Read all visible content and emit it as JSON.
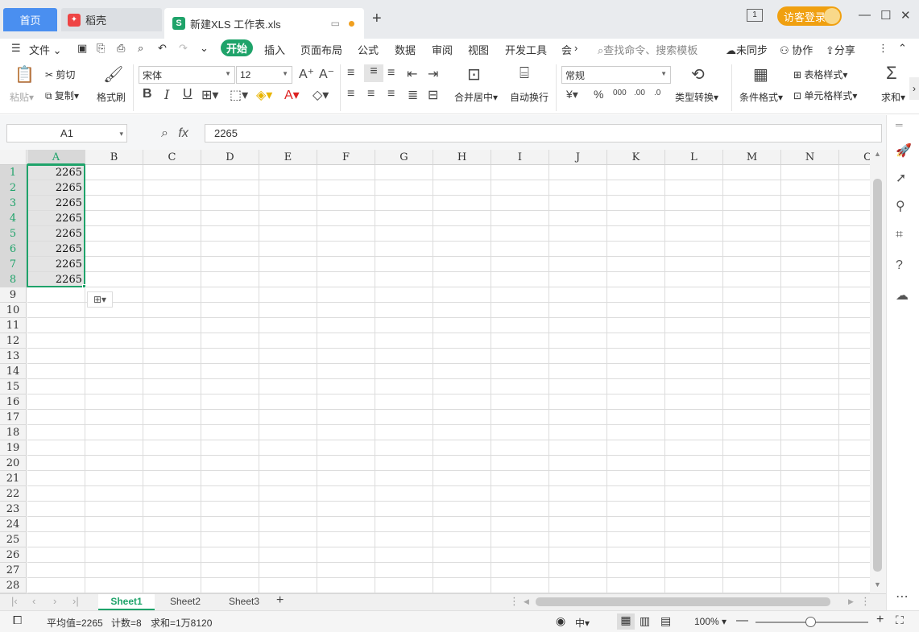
{
  "titlebar": {
    "tabs": [
      {
        "label": "首页"
      },
      {
        "label": "稻壳"
      },
      {
        "label": "新建XLS 工作表.xls"
      }
    ],
    "login_label": "访客登录",
    "page_indicator": "1"
  },
  "menu": {
    "file_label": "文件",
    "items": [
      "开始",
      "插入",
      "页面布局",
      "公式",
      "数据",
      "审阅",
      "视图",
      "开发工具",
      "会"
    ],
    "search_placeholder": "查找命令、搜索模板",
    "sync_label": "未同步",
    "collab_label": "协作",
    "share_label": "分享"
  },
  "ribbon": {
    "paste": "粘贴",
    "cut": "剪切",
    "copy": "复制",
    "format_painter": "格式刷",
    "font_name": "宋体",
    "font_size": "12",
    "merge_center": "合并居中",
    "wrap_text": "自动换行",
    "number_format": "常规",
    "type_convert": "类型转换",
    "cond_format": "条件格式",
    "table_style": "表格样式",
    "cell_style": "单元格样式",
    "sum": "求和"
  },
  "formula_bar": {
    "name_box": "A1",
    "fx": "fx",
    "value": "2265"
  },
  "grid": {
    "columns": [
      "A",
      "B",
      "C",
      "D",
      "E",
      "F",
      "G",
      "H",
      "I",
      "J",
      "K",
      "L",
      "M",
      "N",
      "O"
    ],
    "rows": [
      "1",
      "2",
      "3",
      "4",
      "5",
      "6",
      "7",
      "8",
      "9",
      "10",
      "11",
      "12",
      "13",
      "14",
      "15",
      "16",
      "17",
      "18",
      "19",
      "20",
      "21",
      "22",
      "23",
      "24",
      "25",
      "26",
      "27",
      "28"
    ],
    "column_a_values": [
      "2265",
      "2265",
      "2265",
      "2265",
      "2265",
      "2265",
      "2265",
      "2265"
    ]
  },
  "sheets": {
    "tabs": [
      "Sheet1",
      "Sheet2",
      "Sheet3"
    ],
    "active": "Sheet1"
  },
  "status": {
    "average": "平均值=2265",
    "count": "计数=8",
    "sum": "求和=1万8120",
    "zoom": "100%",
    "lang": "中"
  },
  "colors": {
    "accent": "#1fa36a",
    "home_tab": "#4a8ff0",
    "login": "#f0a010"
  }
}
